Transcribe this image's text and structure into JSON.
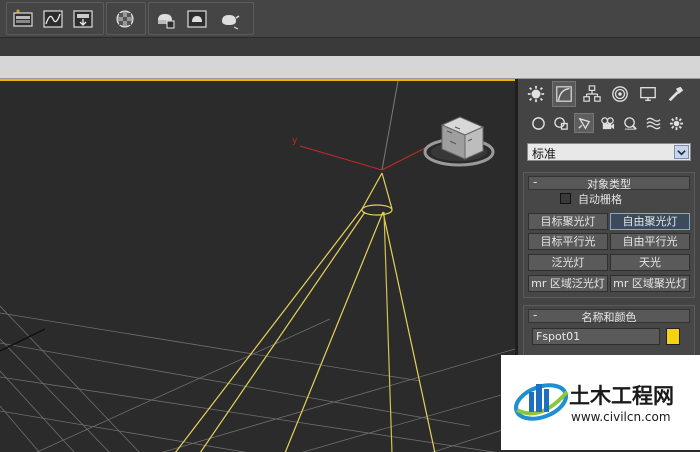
{
  "toolbar": {
    "group1_icons": [
      "layer-manager-icon",
      "curve-editor-icon",
      "schematic-view-icon"
    ],
    "group2_icons": [
      "material-editor-icon"
    ],
    "group3_icons": [
      "render-setup-icon",
      "rendered-frame-icon",
      "render-teapot-icon"
    ]
  },
  "viewport": {
    "axis_label": "y",
    "light_color": "#e6d25a",
    "grid_color": "#6e6e6e"
  },
  "command_panel": {
    "tabs": [
      "create",
      "modify",
      "hierarchy",
      "motion",
      "display",
      "utilities"
    ],
    "active_tab": "create",
    "sub_categories": [
      "geometry",
      "shapes",
      "lights",
      "cameras",
      "helpers",
      "space-warps",
      "systems"
    ],
    "active_sub": "lights",
    "category_dropdown": "标准",
    "object_type": {
      "title": "对象类型",
      "auto_grid_label": "自动栅格",
      "buttons": [
        "目标聚光灯",
        "自由聚光灯",
        "目标平行光",
        "自由平行光",
        "泛光灯",
        "天光",
        "mr 区域泛光灯",
        "mr 区域聚光灯"
      ],
      "selected_button": "自由聚光灯"
    },
    "name_color": {
      "title": "名称和颜色",
      "name": "Fspot01",
      "color": "#f5d312"
    }
  },
  "watermark": {
    "text": "土木工程网",
    "url": "www.civilcn.com"
  }
}
